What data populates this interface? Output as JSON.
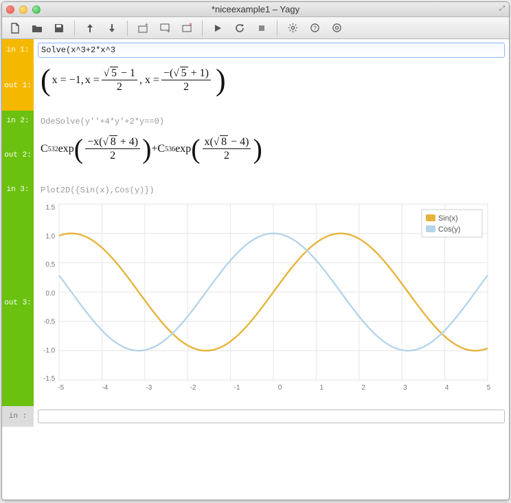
{
  "window": {
    "title": "*niceexample1 – Yagy"
  },
  "toolbar": {
    "new": "New",
    "open": "Open",
    "save": "Save",
    "up": "Up",
    "down": "Down",
    "addabove": "Insert above",
    "addbelow": "Insert below",
    "delete": "Delete cell",
    "run": "Run",
    "reload": "Reload",
    "stop": "Stop",
    "settings": "Settings",
    "help": "Help",
    "target": "Kernel"
  },
  "cells": {
    "in1": {
      "label": "in  1:",
      "value": "Solve(x^3+2*x^3"
    },
    "out1": {
      "label": "out 1:"
    },
    "in2": {
      "label": "in  2:",
      "code": "OdeSolve(y''+4*y'+2*y==0)"
    },
    "out2": {
      "label": "out 2:"
    },
    "in3": {
      "label": "in  3:",
      "code": "Plot2D({Sin(x),Cos(y)})"
    },
    "out3": {
      "label": "out 3:"
    },
    "inN": {
      "label": "in   :"
    }
  },
  "math": {
    "out1": {
      "r1": "x = −1,",
      "r2": "x = ",
      "f2num_a": "5",
      "f2num_b": " − 1",
      "f2den": "2",
      "r3": " , x = ",
      "f3num_a": "−(",
      "f3num_b": "5",
      "f3num_c": " + 1)",
      "f3den": "2"
    },
    "out2": {
      "c1": "C",
      "c1s": "532",
      "exp": " exp",
      "f1num_a": "−x(",
      "f1num_b": "8",
      "f1num_c": " + 4)",
      "f1den": "2",
      "plus": " + ",
      "c2": "C",
      "c2s": "536",
      "f2num_a": "x(",
      "f2num_b": "8",
      "f2num_c": " − 4)",
      "f2den": "2"
    }
  },
  "chart_data": {
    "type": "line",
    "xlabel": "",
    "ylabel": "",
    "xlim": [
      -5,
      5
    ],
    "ylim": [
      -1.5,
      1.5
    ],
    "xticks": [
      -5,
      -4,
      -3,
      -2,
      -1,
      0,
      1,
      2,
      3,
      4,
      5
    ],
    "yticks": [
      1.5,
      1.0,
      0.5,
      0.0,
      -0.5,
      -1.0,
      -1.5
    ],
    "series": [
      {
        "name": "Sin(x)",
        "color": "#e6b43c"
      },
      {
        "name": "Cos(y)",
        "color": "#b6d4ea"
      }
    ],
    "legend": [
      "Sin(x)",
      "Cos(y)"
    ]
  }
}
